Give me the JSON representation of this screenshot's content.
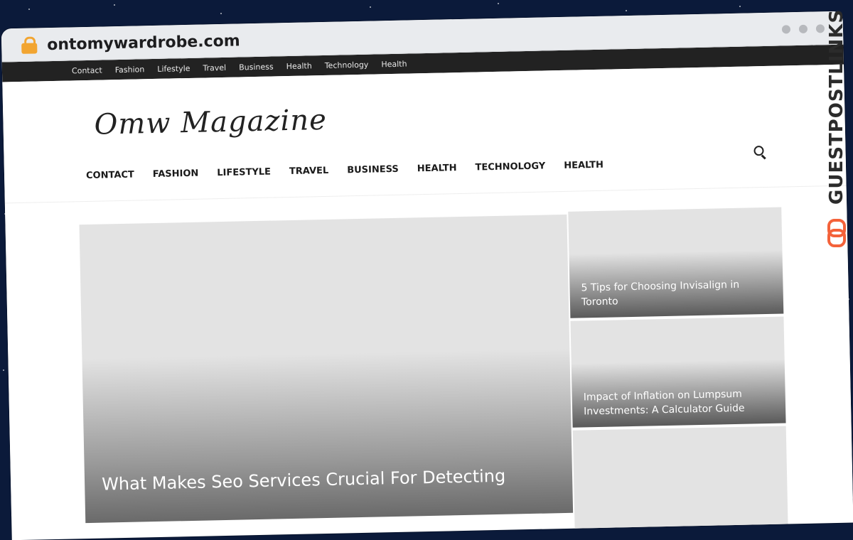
{
  "browser": {
    "url": "ontomywardrobe.com"
  },
  "topbar": {
    "items": [
      "Contact",
      "Fashion",
      "Lifestyle",
      "Travel",
      "Business",
      "Health",
      "Technology",
      "Health"
    ]
  },
  "site": {
    "logo": "Omw Magazine"
  },
  "mainnav": {
    "items": [
      "CONTACT",
      "FASHION",
      "LIFESTYLE",
      "TRAVEL",
      "BUSINESS",
      "HEALTH",
      "TECHNOLOGY",
      "HEALTH"
    ]
  },
  "articles": {
    "hero_title": "What Makes Seo Services Crucial For Detecting",
    "side": [
      {
        "title": "5 Tips for Choosing Invisalign in Toronto"
      },
      {
        "title": "Impact of Inflation on Lumpsum Investments: A Calculator Guide"
      },
      {
        "title": ""
      }
    ]
  },
  "watermark": {
    "text": "GUESTPOSTLINKS"
  },
  "colors": {
    "accent": "#f2a531",
    "topbar_bg": "#222222",
    "watermark_accent": "#f4623a"
  }
}
